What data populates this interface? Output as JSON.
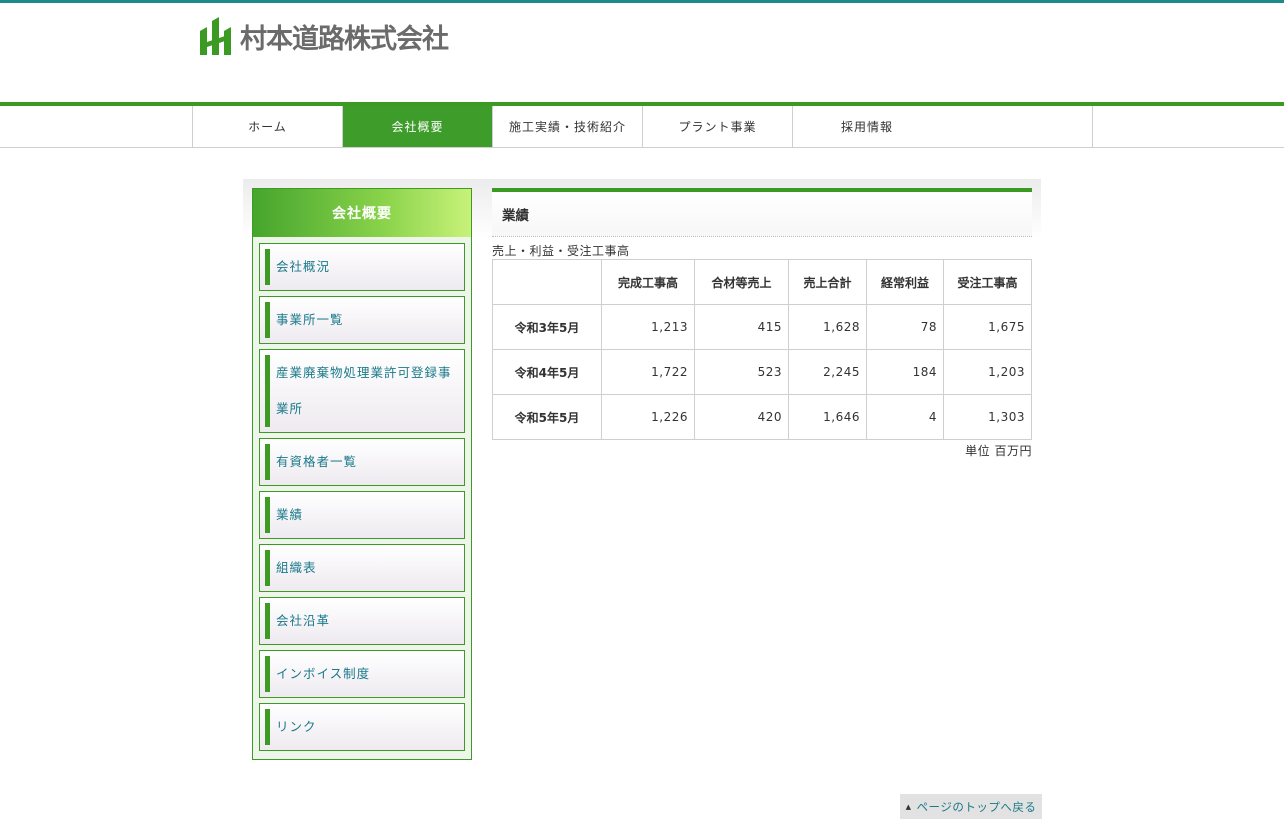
{
  "header": {
    "company_name": "村本道路株式会社"
  },
  "nav": {
    "items": [
      {
        "label": "ホーム"
      },
      {
        "label": "会社概要"
      },
      {
        "label": "施工実績・技術紹介"
      },
      {
        "label": "プラント事業"
      },
      {
        "label": "採用情報"
      }
    ],
    "active_index": 1
  },
  "sidebar": {
    "title": "会社概要",
    "items": [
      {
        "label": "会社概況"
      },
      {
        "label": "事業所一覧"
      },
      {
        "label": "産業廃棄物処理業許可登録事業所"
      },
      {
        "label": "有資格者一覧"
      },
      {
        "label": "業績"
      },
      {
        "label": "組織表"
      },
      {
        "label": "会社沿革"
      },
      {
        "label": "インボイス制度"
      },
      {
        "label": "リンク"
      }
    ]
  },
  "main": {
    "title": "業績",
    "caption": "売上・利益・受注工事高",
    "table": {
      "headers": [
        "",
        "完成工事高",
        "合材等売上",
        "売上合計",
        "経常利益",
        "受注工事高"
      ],
      "rows": [
        [
          "令和3年5月",
          "1,213",
          "415",
          "1,628",
          "78",
          "1,675"
        ],
        [
          "令和4年5月",
          "1,722",
          "523",
          "2,245",
          "184",
          "1,203"
        ],
        [
          "令和5年5月",
          "1,226",
          "420",
          "1,646",
          "4",
          "1,303"
        ]
      ]
    },
    "unit": "単位 百万円"
  },
  "footer": {
    "page_top": "ページのトップへ戻る"
  },
  "colors": {
    "accent_green": "#3d9c2a",
    "link_teal": "#1a7a8a",
    "top_line": "#1f8a8a"
  }
}
